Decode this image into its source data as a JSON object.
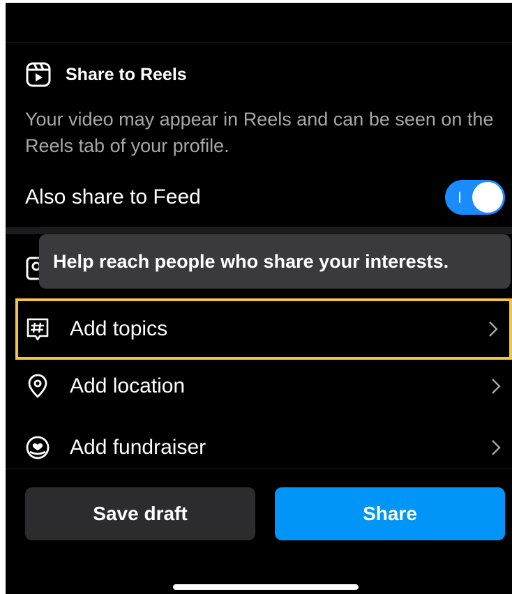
{
  "reels": {
    "title": "Share to Reels",
    "description": "Your video may appear in Reels and can be seen on the Reels tab of your profile.",
    "icon": "reels-icon"
  },
  "feed_toggle": {
    "label": "Also share to Feed",
    "state": "on",
    "color": "#1a8cff"
  },
  "tooltip": {
    "text": "Help reach people who share your interests."
  },
  "rows": [
    {
      "label": "Add topics",
      "icon": "hashtag-icon",
      "highlight_color": "#f5c542"
    },
    {
      "label": "Add location",
      "icon": "location-pin-icon"
    },
    {
      "label": "Add fundraiser",
      "icon": "fundraiser-icon"
    }
  ],
  "buttons": {
    "save_draft": "Save draft",
    "share": "Share",
    "share_color": "#0095f6"
  }
}
